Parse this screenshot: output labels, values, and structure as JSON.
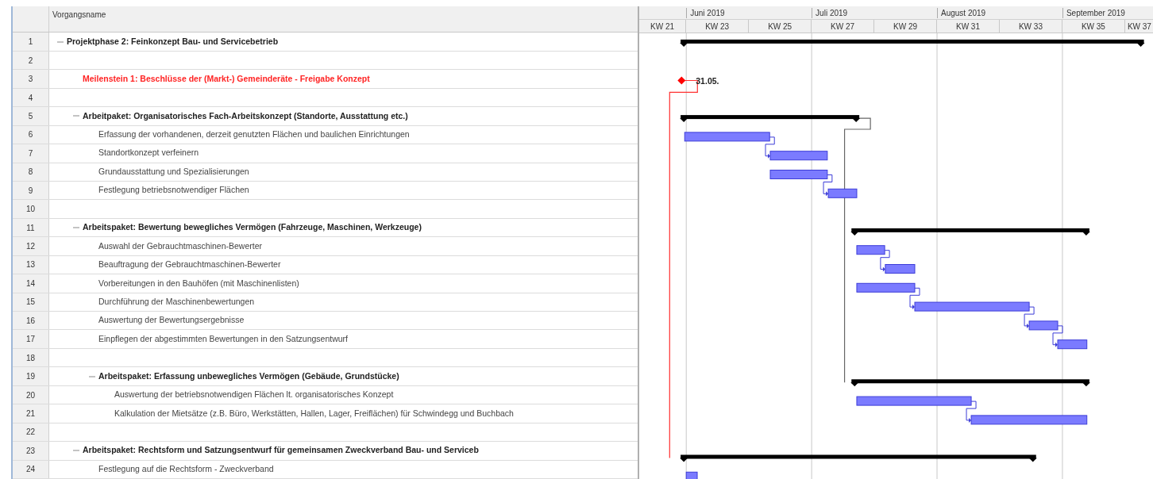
{
  "table": {
    "columns": [
      "Vorgangsname"
    ],
    "rows": [
      {
        "number": "1",
        "name": "Projektphase 2: Feinkonzept Bau- und Servicebetrieb",
        "kind": "summary",
        "expanded": true,
        "children": [
          {
            "number": "2",
            "kind": "blank"
          },
          {
            "number": "3",
            "name": "Meilenstein 1: Beschlüsse der (Markt-) Gemeinderäte - Freigabe Konzept",
            "kind": "milestone"
          },
          {
            "number": "4",
            "kind": "blank"
          },
          {
            "number": "5",
            "name": "Arbeitpaket: Organisatorisches Fach-Arbeitskonzept (Standorte, Ausstattung etc.)",
            "kind": "summary",
            "expanded": true,
            "children": [
              {
                "number": "6",
                "name": "Erfassung der vorhandenen, derzeit genutzten Flächen und baulichen Einrichtungen",
                "kind": "task"
              },
              {
                "number": "7",
                "name": "Standortkonzept verfeinern",
                "kind": "task"
              },
              {
                "number": "8",
                "name": "Grundausstattung und Spezialisierungen",
                "kind": "task"
              },
              {
                "number": "9",
                "name": "Festlegung betriebsnotwendiger Flächen",
                "kind": "task"
              }
            ]
          },
          {
            "number": "10",
            "kind": "blank"
          },
          {
            "number": "11",
            "name": "Arbeitspaket: Bewertung bewegliches Vermögen (Fahrzeuge, Maschinen, Werkzeuge)",
            "kind": "summary",
            "expanded": true,
            "children": [
              {
                "number": "12",
                "name": "Auswahl der Gebrauchtmaschinen-Bewerter",
                "kind": "task"
              },
              {
                "number": "13",
                "name": "Beauftragung der Gebrauchtmaschinen-Bewerter",
                "kind": "task"
              },
              {
                "number": "14",
                "name": "Vorbereitungen in den Bauhöfen (mit Maschinenlisten)",
                "kind": "task"
              },
              {
                "number": "15",
                "name": "Durchführung der Maschinenbewertungen",
                "kind": "task"
              },
              {
                "number": "16",
                "name": "Auswertung der Bewertungsergebnisse",
                "kind": "task"
              },
              {
                "number": "17",
                "name": "Einpflegen der abgestimmten Bewertungen in den Satzungsentwurf",
                "kind": "task"
              },
              {
                "number": "18",
                "kind": "blank"
              },
              {
                "number": "19",
                "name": "Arbeitspaket: Erfassung unbewegliches Vermögen (Gebäude, Grundstücke)",
                "kind": "summary",
                "expanded": true,
                "children": [
                  {
                    "number": "20",
                    "name": "Auswertung der betriebsnotwendigen Flächen lt. organisatorisches Konzept",
                    "kind": "task"
                  },
                  {
                    "number": "21",
                    "name": "Kalkulation der Mietsätze (z.B. Büro, Werkstätten, Hallen, Lager, Freiflächen) für Schwindegg und Buchbach",
                    "kind": "task"
                  }
                ]
              }
            ]
          },
          {
            "number": "22",
            "kind": "blank"
          },
          {
            "number": "23",
            "name": "Arbeitspaket: Rechtsform und Satzungsentwurf für gemeinsamen Zweckverband Bau- und Serviceb",
            "kind": "summary",
            "expanded": true,
            "children": [
              {
                "number": "24",
                "name": "Festlegung auf die Rechtsform - Zweckverband",
                "kind": "task"
              }
            ]
          }
        ]
      }
    ]
  },
  "gantt": {
    "months": [
      "Juni 2019",
      "Juli 2019",
      "August 2019",
      "September 2019"
    ],
    "weeks": [
      "KW 21",
      "KW 23",
      "KW 25",
      "KW 27",
      "KW 29",
      "KW 31",
      "KW 33",
      "KW 35",
      "KW 37"
    ],
    "milestone_date": "31.05."
  }
}
